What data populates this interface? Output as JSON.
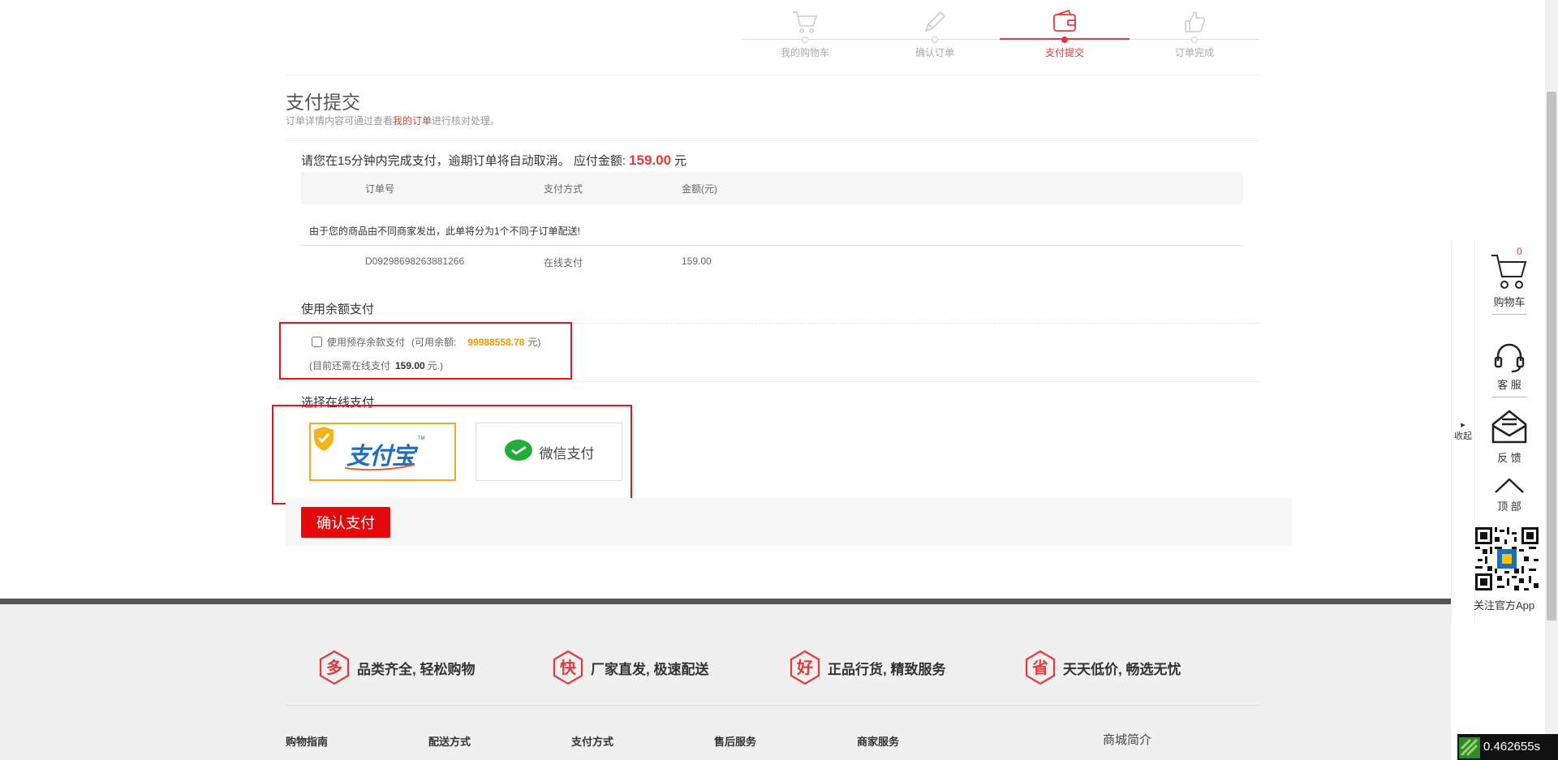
{
  "steps": [
    {
      "label": "我的购物车",
      "icon": "cart-icon",
      "active": false
    },
    {
      "label": "确认订单",
      "icon": "pencil-icon",
      "active": false
    },
    {
      "label": "支付提交",
      "icon": "wallet-icon",
      "active": true
    },
    {
      "label": "订单完成",
      "icon": "thumbs-up-icon",
      "active": false
    }
  ],
  "header": {
    "title": "支付提交",
    "subtitle_pre": "订单详情内容可通过查看",
    "subtitle_link": "我的订单",
    "subtitle_post": "进行核对处理。"
  },
  "notice": {
    "text": "请您在15分钟内完成支付，逾期订单将自动取消。 应付金额:",
    "amount": "159.00",
    "unit": "元"
  },
  "order_table": {
    "columns": [
      "订单号",
      "支付方式",
      "金额(元)"
    ],
    "split_note": "由于您的商品由不同商家发出，此单将分为1个不同子订单配送!",
    "rows": [
      {
        "order_no": "D09298698263881266",
        "method": "在线支付",
        "amount": "159.00"
      }
    ]
  },
  "balance": {
    "section_title": "使用余额支付",
    "checkbox_label": "使用预存余款支付",
    "available_pre": "(可用余额:",
    "available_amount": "99988558.78",
    "available_post": "元)",
    "still_pre": "(目前还需在线支付",
    "still_amount": "159.00",
    "still_post": "元.)",
    "checked": false
  },
  "online_pay": {
    "section_title": "选择在线支付",
    "alipay_label": "支付宝",
    "alipay_tm": "TM",
    "wechat_label": "微信支付",
    "selected": "alipay"
  },
  "confirm": {
    "label": "确认支付"
  },
  "footer": {
    "promises": [
      {
        "char": "多",
        "text": "品类齐全, 轻松购物"
      },
      {
        "char": "快",
        "text": "厂家直发, 极速配送"
      },
      {
        "char": "好",
        "text": "正品行货, 精致服务"
      },
      {
        "char": "省",
        "text": "天天低价, 畅选无忧"
      }
    ],
    "columns": [
      "购物指南",
      "配送方式",
      "支付方式",
      "售后服务",
      "商家服务"
    ],
    "intro": "商城简介"
  },
  "toolbar": {
    "collapse": "收起",
    "cart_label": "购物车",
    "cart_count": "0",
    "service_label": "客 服",
    "feedback_label": "反 馈",
    "top_label": "顶 部",
    "app_label": "关注官方App"
  },
  "timer": "0.462655s",
  "colors": {
    "accent": "#e4393c",
    "highlight_box": "#f20e1b",
    "balance": "#f39800",
    "alipay_border": "#f5a623"
  }
}
